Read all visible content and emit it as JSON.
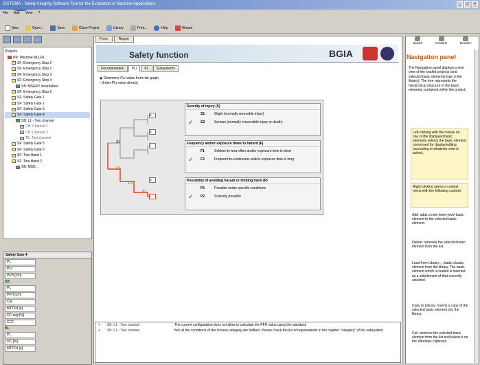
{
  "app": {
    "title": "SISTEMA - Safety Integrity Software Tool for the Evaluation of Machine Applications"
  },
  "menu": [
    "File",
    "Edit",
    "View",
    "?"
  ],
  "toolbar": [
    {
      "icon": "new-icon",
      "label": "New"
    },
    {
      "icon": "open-icon",
      "label": "Open..."
    },
    {
      "icon": "save-icon",
      "label": "Save"
    },
    {
      "icon": "close-project-icon",
      "label": "Close Project"
    },
    {
      "icon": "library-icon",
      "label": "Library"
    },
    {
      "icon": "print-icon",
      "label": "Print..."
    },
    {
      "icon": "help-icon",
      "label": "Help"
    },
    {
      "icon": "wizard-icon",
      "label": "Wizard"
    }
  ],
  "tree": {
    "root": "Projects",
    "items": [
      "PR: Machine MLLR1",
      "SF: Emergency Stop 1",
      "SF: Emergency Stop 2",
      "SF: Emergency Stop 3",
      "SF: Emergency Stop 4",
      "SB: MSERV innerhalber",
      "SF: Emergency Stop 5",
      "SF: Safety Gate 1",
      "SF: Safety Gate 2",
      "SF: Safety Gate 3",
      "SF: Safety Gate 4",
      "SB: L1 - Two channel",
      "CH: Channel 1",
      "CH: Channel 2",
      "TE: Test channel",
      "SF: Safety Gate 5",
      "SF: Safety Gate 6",
      "SF: Two-Hand 1",
      "SF: Two-Hand 2",
      "SB: MSD..."
    ]
  },
  "sgpanel": {
    "title": "Safety Gate 4",
    "rows": [
      "PL",
      "PLr",
      "PFH [1/h]"
    ],
    "extra": [
      "PL",
      "PFH [1/h]",
      "Cat.",
      "MTTFd [a]",
      "DC avg [%]",
      "CCF",
      "PL",
      "DC [%]",
      "MTTFd [a]",
      "DC [%]"
    ]
  },
  "center": {
    "tabs": [
      "Form",
      "Report"
    ],
    "heading": "Safety function",
    "bgia": "BGIA",
    "subtabs": [
      "Documentation",
      "PLr",
      "PL",
      "Subsystems"
    ],
    "radio_options": [
      "Determine PLr value from risk graph",
      "Enter PLr value directly"
    ],
    "severity": {
      "title": "Severity of injury (S)",
      "options": [
        {
          "code": "S1",
          "text": "Slight (normally reversible injury)",
          "checked": false
        },
        {
          "code": "S2",
          "text": "Serious (normally irreversible injury or death)",
          "checked": true
        }
      ]
    },
    "frequency": {
      "title": "Frequency and/or exposure times to hazard (F)",
      "options": [
        {
          "code": "F1",
          "text": "Seldom-to-less-often and/or exposure time is short",
          "checked": false
        },
        {
          "code": "F2",
          "text": "Frequent-to-continuous and/or exposure time is long",
          "checked": true
        }
      ]
    },
    "possibility": {
      "title": "Possibility of avoiding hazard or limiting harm (P)",
      "options": [
        {
          "code": "P1",
          "text": "Possible under specific conditions",
          "checked": false
        },
        {
          "code": "P2",
          "text": "Scarcely possible",
          "checked": true
        }
      ]
    },
    "graph_labels": {
      "s1": "S1",
      "s2": "S2",
      "f1": "F1",
      "f2": "F2",
      "p1": "P1",
      "p2": "P2",
      "levels": [
        "a",
        "b",
        "c",
        "d",
        "e"
      ]
    },
    "messages": [
      {
        "source": "SB: L1 - Two channel",
        "text": "The current configuration does not allow to calculate the PFH value using the standard."
      },
      {
        "source": "SB: L1 - Two channel",
        "text": "Not all the conditions of the chosen category are fulfilled. Please check the list of requirements in the register \"category\" of the subsystem."
      }
    ]
  },
  "right": {
    "toolbar": [
      "Zurück",
      "Vorwärts",
      "Drucken"
    ],
    "title": "Navigation panel",
    "intro": "The Navigation panel displays a tree view of the loaded projects (and selected basic elements type in the library). The tree represents the hierarchical structure of the basic elements contained within the project.",
    "leftclick": "Left-clicking with the mouse on one of the displayed basic elements selects the basic element concerned for display/editing (according to whatever view is active).",
    "rightclick": "Right-clicking opens a context menu with the following content:",
    "bullets": [
      "Add: adds a new lower-level basic element to the selected basic element.",
      "Delete: removes the selected basic element from the list.",
      "Load from Library...: loads a basic element from the library. The basic element which is loaded is inserted as a subelement of that currently selected.",
      "Copy to Library: inserts a copy of the selected basic element into the library.",
      "Cut: removes the selected basic element from the list and places it on the Windows clipboard."
    ]
  },
  "colors": {
    "accent": "#cc5500",
    "check": "#4a9b2e",
    "riskpath": "#e0401a"
  }
}
